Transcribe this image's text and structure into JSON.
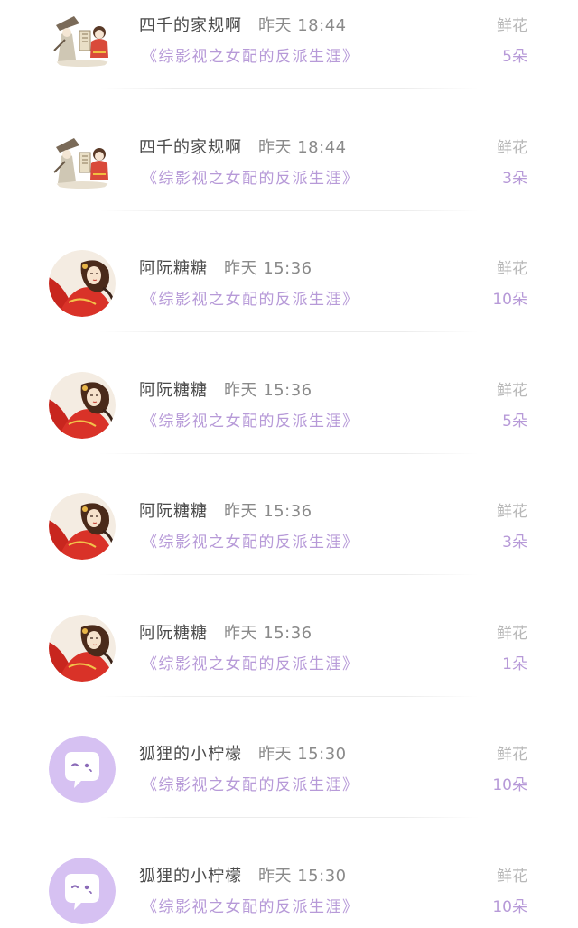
{
  "rows": [
    {
      "avatar": "ink-sketch-scholar-avatar",
      "user": "四千的家规啊",
      "time": "昨天 18:44",
      "book": "《综影视之女配的反派生涯》",
      "gift_label": "鲜花",
      "count": "5朵"
    },
    {
      "avatar": "ink-sketch-scholar-avatar",
      "user": "四千的家规啊",
      "time": "昨天 18:44",
      "book": "《综影视之女配的反派生涯》",
      "gift_label": "鲜花",
      "count": "3朵"
    },
    {
      "avatar": "red-robed-girl-avatar",
      "user": "阿阮糖糖",
      "time": "昨天 15:36",
      "book": "《综影视之女配的反派生涯》",
      "gift_label": "鲜花",
      "count": "10朵"
    },
    {
      "avatar": "red-robed-girl-avatar",
      "user": "阿阮糖糖",
      "time": "昨天 15:36",
      "book": "《综影视之女配的反派生涯》",
      "gift_label": "鲜花",
      "count": "5朵"
    },
    {
      "avatar": "red-robed-girl-avatar",
      "user": "阿阮糖糖",
      "time": "昨天 15:36",
      "book": "《综影视之女配的反派生涯》",
      "gift_label": "鲜花",
      "count": "3朵"
    },
    {
      "avatar": "red-robed-girl-avatar",
      "user": "阿阮糖糖",
      "time": "昨天 15:36",
      "book": "《综影视之女配的反派生涯》",
      "gift_label": "鲜花",
      "count": "1朵"
    },
    {
      "avatar": "purple-chat-bubble-avatar",
      "user": "狐狸的小柠檬",
      "time": "昨天 15:30",
      "book": "《综影视之女配的反派生涯》",
      "gift_label": "鲜花",
      "count": "10朵"
    },
    {
      "avatar": "purple-chat-bubble-avatar",
      "user": "狐狸的小柠檬",
      "time": "昨天 15:30",
      "book": "《综影视之女配的反派生涯》",
      "gift_label": "鲜花",
      "count": "10朵"
    }
  ],
  "colors": {
    "accent_purple": "#b79ad8",
    "avatar_purple": "#d6c1f2",
    "name_gray": "#4a4a4a",
    "label_gray": "#b8b8b8"
  }
}
